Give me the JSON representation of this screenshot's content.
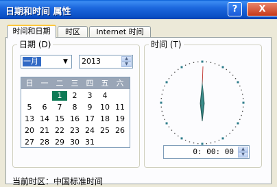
{
  "window": {
    "title": "日期和时间 属性",
    "help_label": "?",
    "close_label": "X"
  },
  "tabs": [
    {
      "label": "时间和日期",
      "active": true
    },
    {
      "label": "时区",
      "active": false
    },
    {
      "label": "Internet 时间",
      "active": false
    }
  ],
  "date_group": {
    "label": "日期 (D)",
    "month_value": "一月",
    "year_value": "2013",
    "weekdays": [
      "日",
      "一",
      "二",
      "三",
      "四",
      "五",
      "六"
    ],
    "selected_day": "1",
    "days": [
      [
        "",
        "",
        "",
        "1",
        "2",
        "3",
        "4"
      ],
      [
        "5",
        "6",
        "7",
        "8",
        "9",
        "10",
        "11",
        "12"
      ],
      [
        "13",
        "14",
        "15",
        "16",
        "17",
        "18",
        "19"
      ],
      [
        "20",
        "21",
        "22",
        "23",
        "24",
        "25",
        "26"
      ],
      [
        "27",
        "28",
        "29",
        "30",
        "31",
        "",
        ""
      ]
    ]
  },
  "time_group": {
    "label": "时间 (T)",
    "time_value": "0: 00: 00"
  },
  "timezone_text": "当前时区：中国标准时间",
  "colors": {
    "title_bar": "#0a4fc4",
    "selected_day": "#0d7a55",
    "calendar_header": "#9aa6b7"
  }
}
